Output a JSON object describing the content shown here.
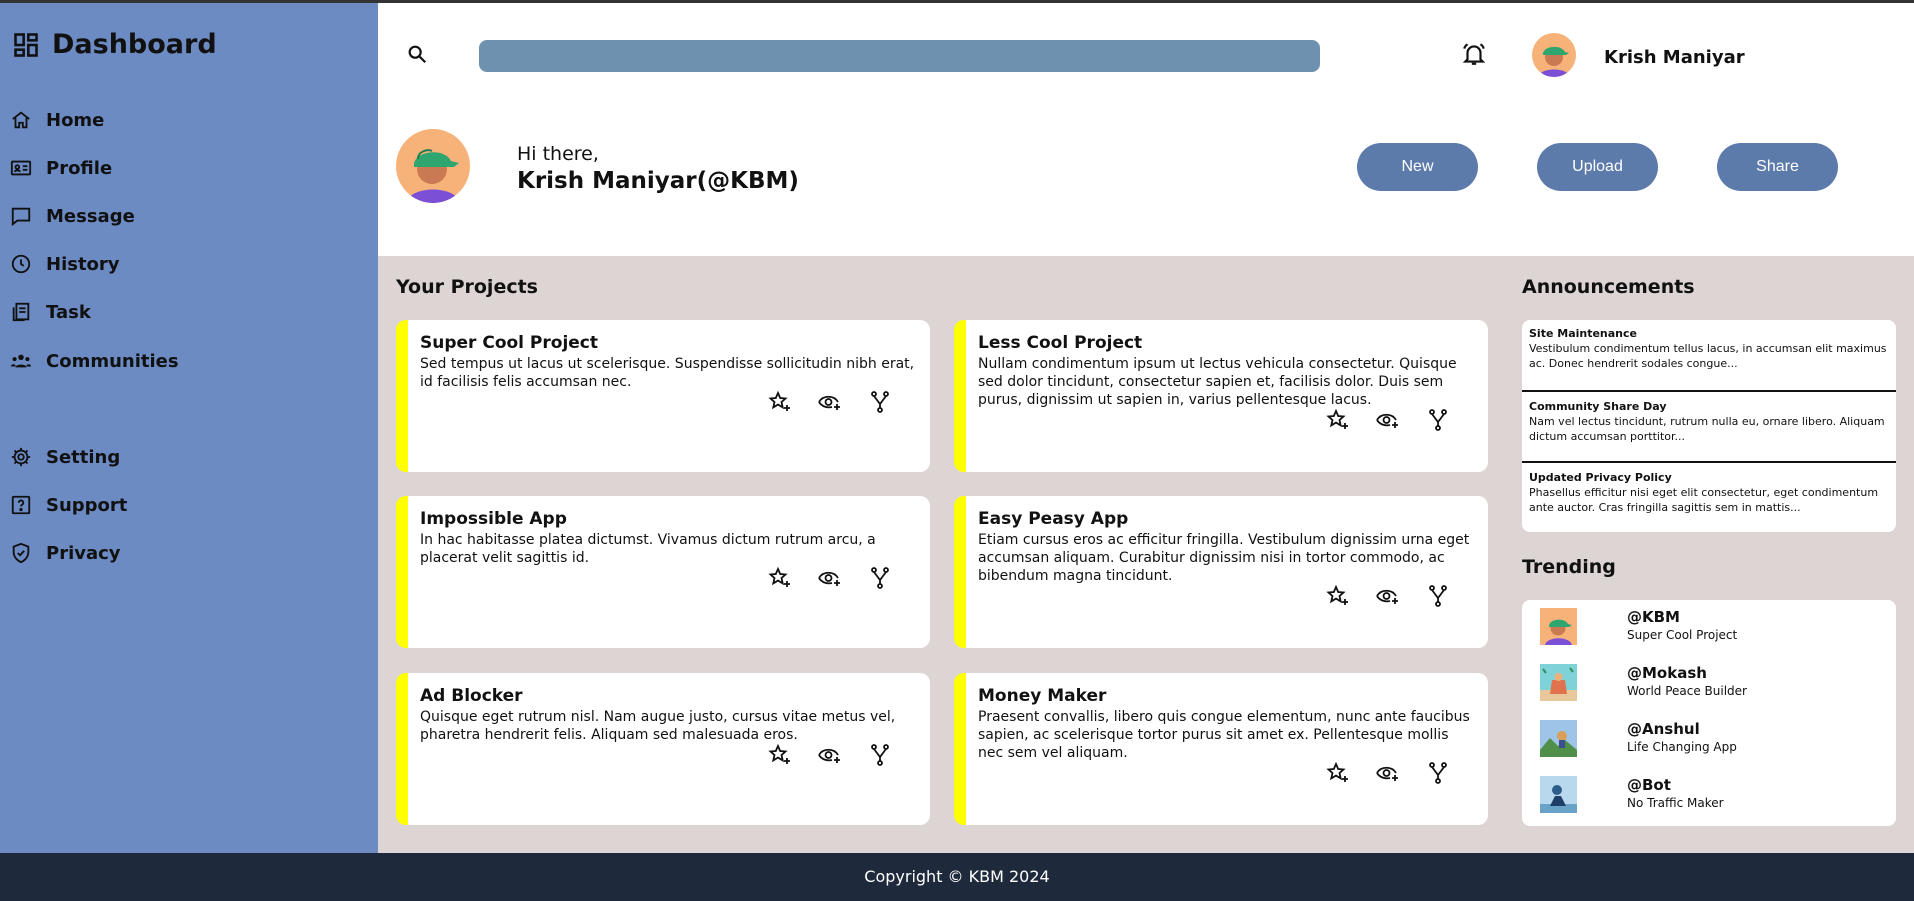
{
  "sidebar": {
    "brand": "Dashboard",
    "items": [
      {
        "label": "Home",
        "icon": "home-icon"
      },
      {
        "label": "Profile",
        "icon": "profile-card-icon"
      },
      {
        "label": "Message",
        "icon": "message-icon"
      },
      {
        "label": "History",
        "icon": "clock-icon"
      },
      {
        "label": "Task",
        "icon": "task-icon"
      },
      {
        "label": "Communities",
        "icon": "people-icon"
      },
      {
        "label": "Setting",
        "icon": "gear-icon"
      },
      {
        "label": "Support",
        "icon": "help-icon"
      },
      {
        "label": "Privacy",
        "icon": "shield-icon"
      }
    ]
  },
  "header": {
    "search_value": "",
    "username": "Krish Maniyar",
    "greeting": "Hi there,",
    "full_name": "Krish Maniyar(@KBM)",
    "actions": [
      "New",
      "Upload",
      "Share"
    ]
  },
  "projects": {
    "title": "Your Projects",
    "items": [
      {
        "title": "Super Cool Project",
        "desc": "Sed tempus ut lacus ut scelerisque. Suspendisse sollicitudin nibh erat, id facilisis felis accumsan nec."
      },
      {
        "title": "Less Cool Project",
        "desc": "Nullam condimentum ipsum ut lectus vehicula consectetur. Quisque sed dolor tincidunt, consectetur sapien et, facilisis dolor. Duis sem purus, dignissim ut sapien in, varius pellentesque lacus."
      },
      {
        "title": "Impossible App",
        "desc": "In hac habitasse platea dictumst. Vivamus dictum rutrum arcu, a placerat velit sagittis id."
      },
      {
        "title": "Easy Peasy App",
        "desc": "Etiam cursus eros ac efficitur fringilla. Vestibulum dignissim urna eget accumsan aliquam. Curabitur dignissim nisi in tortor commodo, ac bibendum magna tincidunt."
      },
      {
        "title": "Ad Blocker",
        "desc": "Quisque eget rutrum nisl. Nam augue justo, cursus vitae metus vel, pharetra hendrerit felis. Aliquam sed malesuada eros."
      },
      {
        "title": "Money Maker",
        "desc": "Praesent convallis, libero quis congue elementum, nunc ante faucibus sapien, ac scelerisque tortor purus sit amet ex. Pellentesque mollis nec sem vel aliquam."
      }
    ]
  },
  "announcements": {
    "title": "Announcements",
    "items": [
      {
        "title": "Site Maintenance",
        "text": "Vestibulum condimentum tellus lacus, in accumsan elit maximus ac. Donec hendrerit sodales congue..."
      },
      {
        "title": "Community Share Day",
        "text": "Nam vel lectus tincidunt, rutrum nulla eu, ornare libero. Aliquam dictum accumsan porttitor..."
      },
      {
        "title": "Updated Privacy Policy",
        "text": "Phasellus efficitur nisi eget elit consectetur, eget condimentum ante auctor. Cras fringilla sagittis sem in mattis..."
      }
    ]
  },
  "trending": {
    "title": "Trending",
    "items": [
      {
        "user": "@KBM",
        "project": "Super Cool Project"
      },
      {
        "user": "@Mokash",
        "project": "World Peace Builder"
      },
      {
        "user": "@Anshul",
        "project": "Life Changing App"
      },
      {
        "user": "@Bot",
        "project": "No Traffic Maker"
      }
    ]
  },
  "footer": {
    "text": "Copyright © KBM 2024"
  },
  "colors": {
    "sidebar": "#6c8bc3",
    "accent_button": "#5c7aaa",
    "card_stripe": "#ffff00",
    "content_bg": "#ddd4d4",
    "footer": "#1e293b"
  }
}
